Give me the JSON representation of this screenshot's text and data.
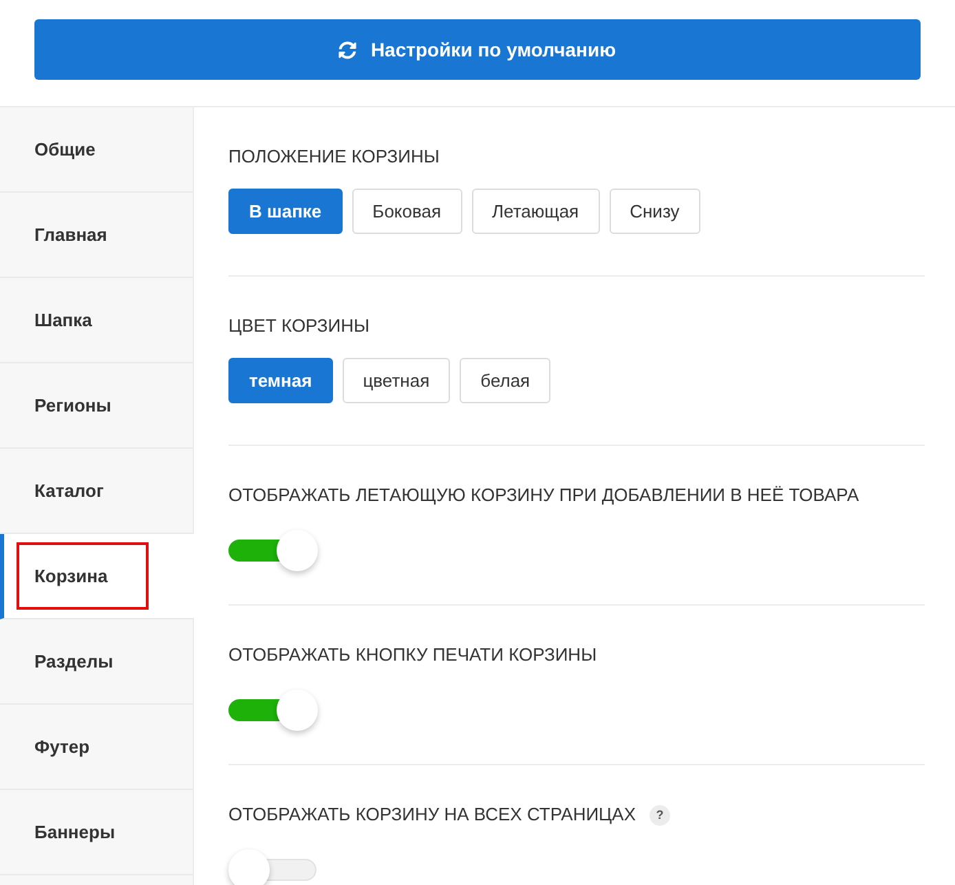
{
  "reset_button": {
    "label": "Настройки по умолчанию"
  },
  "sidebar": {
    "items": [
      {
        "label": "Общие",
        "selected": false,
        "highlighted": false
      },
      {
        "label": "Главная",
        "selected": false,
        "highlighted": false
      },
      {
        "label": "Шапка",
        "selected": false,
        "highlighted": false
      },
      {
        "label": "Регионы",
        "selected": false,
        "highlighted": false
      },
      {
        "label": "Каталог",
        "selected": false,
        "highlighted": false
      },
      {
        "label": "Корзина",
        "selected": true,
        "highlighted": true
      },
      {
        "label": "Разделы",
        "selected": false,
        "highlighted": false
      },
      {
        "label": "Футер",
        "selected": false,
        "highlighted": false
      },
      {
        "label": "Баннеры",
        "selected": false,
        "highlighted": false
      }
    ]
  },
  "sections": [
    {
      "kind": "choice",
      "title": "ПОЛОЖЕНИЕ КОРЗИНЫ",
      "options": [
        {
          "label": "В шапке",
          "selected": true
        },
        {
          "label": "Боковая",
          "selected": false
        },
        {
          "label": "Летающая",
          "selected": false
        },
        {
          "label": "Снизу",
          "selected": false
        }
      ]
    },
    {
      "kind": "choice",
      "title": "ЦВЕТ КОРЗИНЫ",
      "options": [
        {
          "label": "темная",
          "selected": true
        },
        {
          "label": "цветная",
          "selected": false
        },
        {
          "label": "белая",
          "selected": false
        }
      ]
    },
    {
      "kind": "toggle",
      "title": "ОТОБРАЖАТЬ ЛЕТАЮЩУЮ КОРЗИНУ ПРИ ДОБАВЛЕНИИ В НЕЁ ТОВАРА",
      "on": true
    },
    {
      "kind": "toggle",
      "title": "ОТОБРАЖАТЬ КНОПКУ ПЕЧАТИ КОРЗИНЫ",
      "on": true
    },
    {
      "kind": "toggle",
      "title": "ОТОБРАЖАТЬ КОРЗИНУ НА ВСЕХ СТРАНИЦАХ",
      "hint": "?",
      "on": false
    }
  ]
}
